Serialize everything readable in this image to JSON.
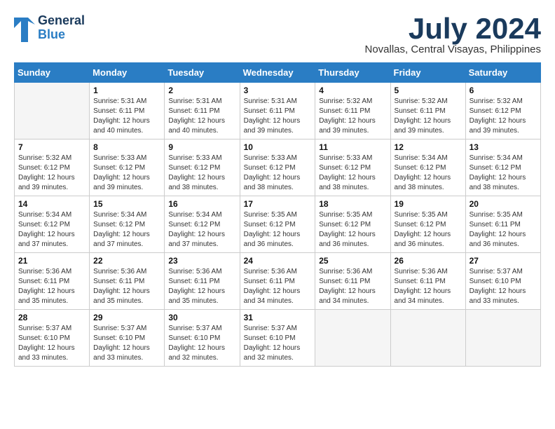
{
  "logo": {
    "line1": "General",
    "line2": "Blue"
  },
  "title": {
    "month_year": "July 2024",
    "location": "Novallas, Central Visayas, Philippines"
  },
  "days_of_week": [
    "Sunday",
    "Monday",
    "Tuesday",
    "Wednesday",
    "Thursday",
    "Friday",
    "Saturday"
  ],
  "weeks": [
    [
      {
        "day": "",
        "info": ""
      },
      {
        "day": "1",
        "info": "Sunrise: 5:31 AM\nSunset: 6:11 PM\nDaylight: 12 hours\nand 40 minutes."
      },
      {
        "day": "2",
        "info": "Sunrise: 5:31 AM\nSunset: 6:11 PM\nDaylight: 12 hours\nand 40 minutes."
      },
      {
        "day": "3",
        "info": "Sunrise: 5:31 AM\nSunset: 6:11 PM\nDaylight: 12 hours\nand 39 minutes."
      },
      {
        "day": "4",
        "info": "Sunrise: 5:32 AM\nSunset: 6:11 PM\nDaylight: 12 hours\nand 39 minutes."
      },
      {
        "day": "5",
        "info": "Sunrise: 5:32 AM\nSunset: 6:11 PM\nDaylight: 12 hours\nand 39 minutes."
      },
      {
        "day": "6",
        "info": "Sunrise: 5:32 AM\nSunset: 6:12 PM\nDaylight: 12 hours\nand 39 minutes."
      }
    ],
    [
      {
        "day": "7",
        "info": "Sunrise: 5:32 AM\nSunset: 6:12 PM\nDaylight: 12 hours\nand 39 minutes."
      },
      {
        "day": "8",
        "info": "Sunrise: 5:33 AM\nSunset: 6:12 PM\nDaylight: 12 hours\nand 39 minutes."
      },
      {
        "day": "9",
        "info": "Sunrise: 5:33 AM\nSunset: 6:12 PM\nDaylight: 12 hours\nand 38 minutes."
      },
      {
        "day": "10",
        "info": "Sunrise: 5:33 AM\nSunset: 6:12 PM\nDaylight: 12 hours\nand 38 minutes."
      },
      {
        "day": "11",
        "info": "Sunrise: 5:33 AM\nSunset: 6:12 PM\nDaylight: 12 hours\nand 38 minutes."
      },
      {
        "day": "12",
        "info": "Sunrise: 5:34 AM\nSunset: 6:12 PM\nDaylight: 12 hours\nand 38 minutes."
      },
      {
        "day": "13",
        "info": "Sunrise: 5:34 AM\nSunset: 6:12 PM\nDaylight: 12 hours\nand 38 minutes."
      }
    ],
    [
      {
        "day": "14",
        "info": "Sunrise: 5:34 AM\nSunset: 6:12 PM\nDaylight: 12 hours\nand 37 minutes."
      },
      {
        "day": "15",
        "info": "Sunrise: 5:34 AM\nSunset: 6:12 PM\nDaylight: 12 hours\nand 37 minutes."
      },
      {
        "day": "16",
        "info": "Sunrise: 5:34 AM\nSunset: 6:12 PM\nDaylight: 12 hours\nand 37 minutes."
      },
      {
        "day": "17",
        "info": "Sunrise: 5:35 AM\nSunset: 6:12 PM\nDaylight: 12 hours\nand 36 minutes."
      },
      {
        "day": "18",
        "info": "Sunrise: 5:35 AM\nSunset: 6:12 PM\nDaylight: 12 hours\nand 36 minutes."
      },
      {
        "day": "19",
        "info": "Sunrise: 5:35 AM\nSunset: 6:12 PM\nDaylight: 12 hours\nand 36 minutes."
      },
      {
        "day": "20",
        "info": "Sunrise: 5:35 AM\nSunset: 6:11 PM\nDaylight: 12 hours\nand 36 minutes."
      }
    ],
    [
      {
        "day": "21",
        "info": "Sunrise: 5:36 AM\nSunset: 6:11 PM\nDaylight: 12 hours\nand 35 minutes."
      },
      {
        "day": "22",
        "info": "Sunrise: 5:36 AM\nSunset: 6:11 PM\nDaylight: 12 hours\nand 35 minutes."
      },
      {
        "day": "23",
        "info": "Sunrise: 5:36 AM\nSunset: 6:11 PM\nDaylight: 12 hours\nand 35 minutes."
      },
      {
        "day": "24",
        "info": "Sunrise: 5:36 AM\nSunset: 6:11 PM\nDaylight: 12 hours\nand 34 minutes."
      },
      {
        "day": "25",
        "info": "Sunrise: 5:36 AM\nSunset: 6:11 PM\nDaylight: 12 hours\nand 34 minutes."
      },
      {
        "day": "26",
        "info": "Sunrise: 5:36 AM\nSunset: 6:11 PM\nDaylight: 12 hours\nand 34 minutes."
      },
      {
        "day": "27",
        "info": "Sunrise: 5:37 AM\nSunset: 6:10 PM\nDaylight: 12 hours\nand 33 minutes."
      }
    ],
    [
      {
        "day": "28",
        "info": "Sunrise: 5:37 AM\nSunset: 6:10 PM\nDaylight: 12 hours\nand 33 minutes."
      },
      {
        "day": "29",
        "info": "Sunrise: 5:37 AM\nSunset: 6:10 PM\nDaylight: 12 hours\nand 33 minutes."
      },
      {
        "day": "30",
        "info": "Sunrise: 5:37 AM\nSunset: 6:10 PM\nDaylight: 12 hours\nand 32 minutes."
      },
      {
        "day": "31",
        "info": "Sunrise: 5:37 AM\nSunset: 6:10 PM\nDaylight: 12 hours\nand 32 minutes."
      },
      {
        "day": "",
        "info": ""
      },
      {
        "day": "",
        "info": ""
      },
      {
        "day": "",
        "info": ""
      }
    ]
  ]
}
